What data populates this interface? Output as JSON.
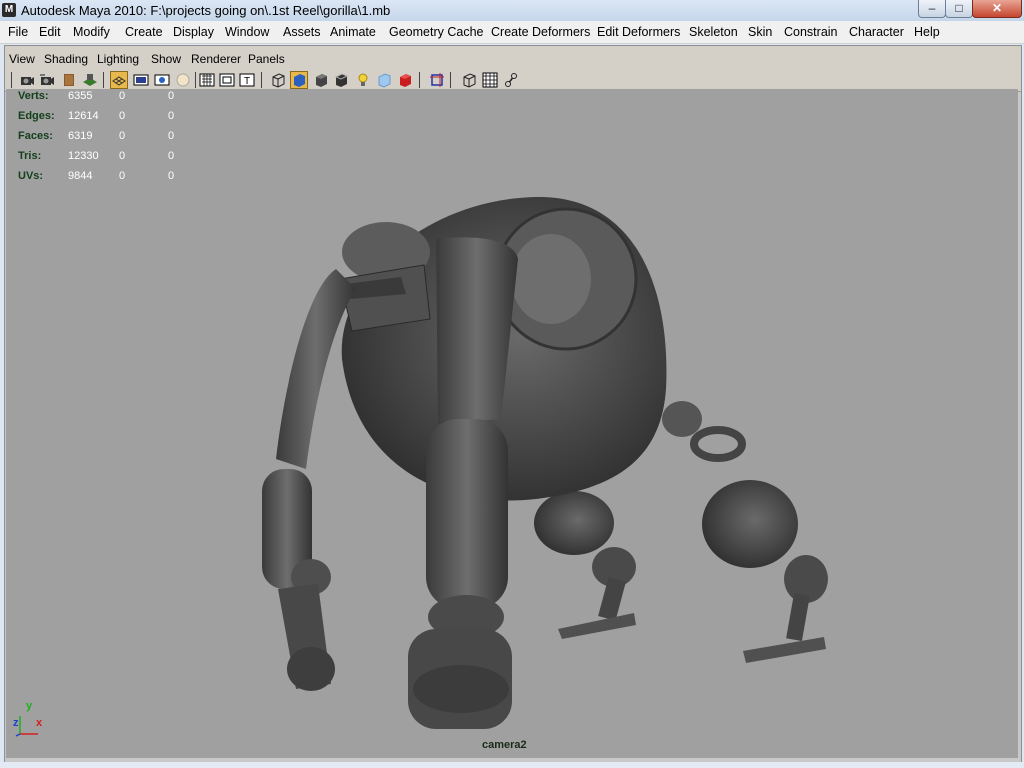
{
  "window": {
    "title": "Autodesk Maya 2010: F:\\projects going on\\.1st Reel\\gorilla\\1.mb",
    "app_icon": "maya-logo-icon"
  },
  "menubar": [
    "File",
    "Edit",
    "Modify",
    "Create",
    "Display",
    "Window",
    "Assets",
    "Animate",
    "Geometry Cache",
    "Create Deformers",
    "Edit Deformers",
    "Skeleton",
    "Skin",
    "Constrain",
    "Character",
    "Help"
  ],
  "panel_menu": [
    "View",
    "Shading",
    "Lighting",
    "Show",
    "Renderer",
    "Panels"
  ],
  "toolbar_icons": [
    "camera-select-icon",
    "camera-attributes-icon",
    "bookmark-icon",
    "image-plane-icon",
    "wireframe-grid-icon",
    "film-gate-icon",
    "resolution-gate-icon",
    "gate-mask-icon",
    "field-chart-icon",
    "safe-action-icon",
    "safe-title-icon",
    "wireframe-icon",
    "smooth-shade-icon",
    "flat-shade-icon",
    "shade-wireframe-icon",
    "lights-icon",
    "xray-icon",
    "textured-icon",
    "isolate-select-icon",
    "bounding-box-icon",
    "grid-toggle-icon",
    "joint-xray-icon"
  ],
  "hud": {
    "rows": [
      {
        "label": "Verts:",
        "v1": "6355",
        "v2": "0",
        "v3": "0"
      },
      {
        "label": "Edges:",
        "v1": "12614",
        "v2": "0",
        "v3": "0"
      },
      {
        "label": "Faces:",
        "v1": "6319",
        "v2": "0",
        "v3": "0"
      },
      {
        "label": "Tris:",
        "v1": "12330",
        "v2": "0",
        "v3": "0"
      },
      {
        "label": "UVs:",
        "v1": "9844",
        "v2": "0",
        "v3": "0"
      }
    ]
  },
  "viewport": {
    "camera": "camera2",
    "axis": {
      "x": "x",
      "y": "y",
      "z": "z"
    },
    "background": "#a0a0a0",
    "model": "gorilla-robot-model"
  },
  "colors": {
    "hud_label": "#14401c",
    "hud_value": "#ffffff",
    "axis_x": "#d42020",
    "axis_y": "#20b020",
    "axis_z": "#2040d0"
  }
}
